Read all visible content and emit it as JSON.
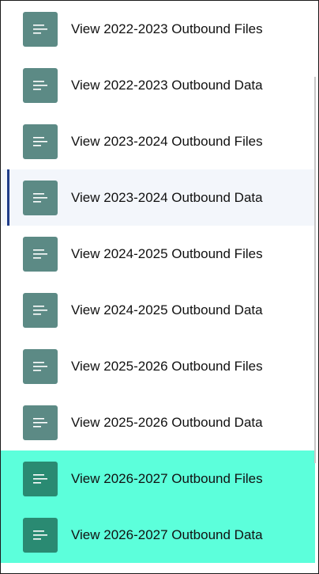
{
  "menu": {
    "items": [
      {
        "label": "View 2022-2023 Outbound Files",
        "state": "normal"
      },
      {
        "label": "View 2022-2023 Outbound Data",
        "state": "normal"
      },
      {
        "label": "View 2023-2024 Outbound Files",
        "state": "normal"
      },
      {
        "label": "View 2023-2024 Outbound Data",
        "state": "active"
      },
      {
        "label": "View 2024-2025 Outbound Files",
        "state": "normal"
      },
      {
        "label": "View 2024-2025 Outbound Data",
        "state": "normal"
      },
      {
        "label": "View 2025-2026 Outbound Files",
        "state": "normal"
      },
      {
        "label": "View 2025-2026 Outbound Data",
        "state": "normal"
      },
      {
        "label": "View 2026-2027 Outbound Files",
        "state": "highlight"
      },
      {
        "label": "View 2026-2027 Outbound Data",
        "state": "highlight"
      }
    ],
    "icon": "document-lines-icon"
  },
  "colors": {
    "icon_bg": "#5c8a85",
    "icon_bg_highlight": "#2a8a72",
    "highlight_bg": "#5cffdb",
    "active_bg": "#f3f6fb",
    "active_indicator": "#1f3c88"
  }
}
